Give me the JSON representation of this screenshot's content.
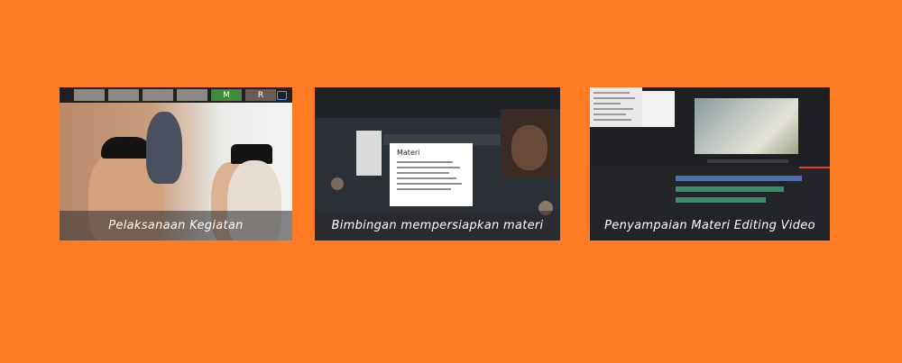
{
  "cards": [
    {
      "caption": "Pelaksanaan Kegiatan",
      "tiles": [
        "M",
        "R"
      ]
    },
    {
      "caption": "Bimbingan mempersiapkan materi",
      "doc_title": "Materi"
    },
    {
      "caption": "Penyampaian Materi Editing Video"
    }
  ],
  "colors": {
    "background": "#ff7c24",
    "caption_bg": "rgba(40,40,45,0.55)",
    "caption_text": "#ffffff"
  }
}
